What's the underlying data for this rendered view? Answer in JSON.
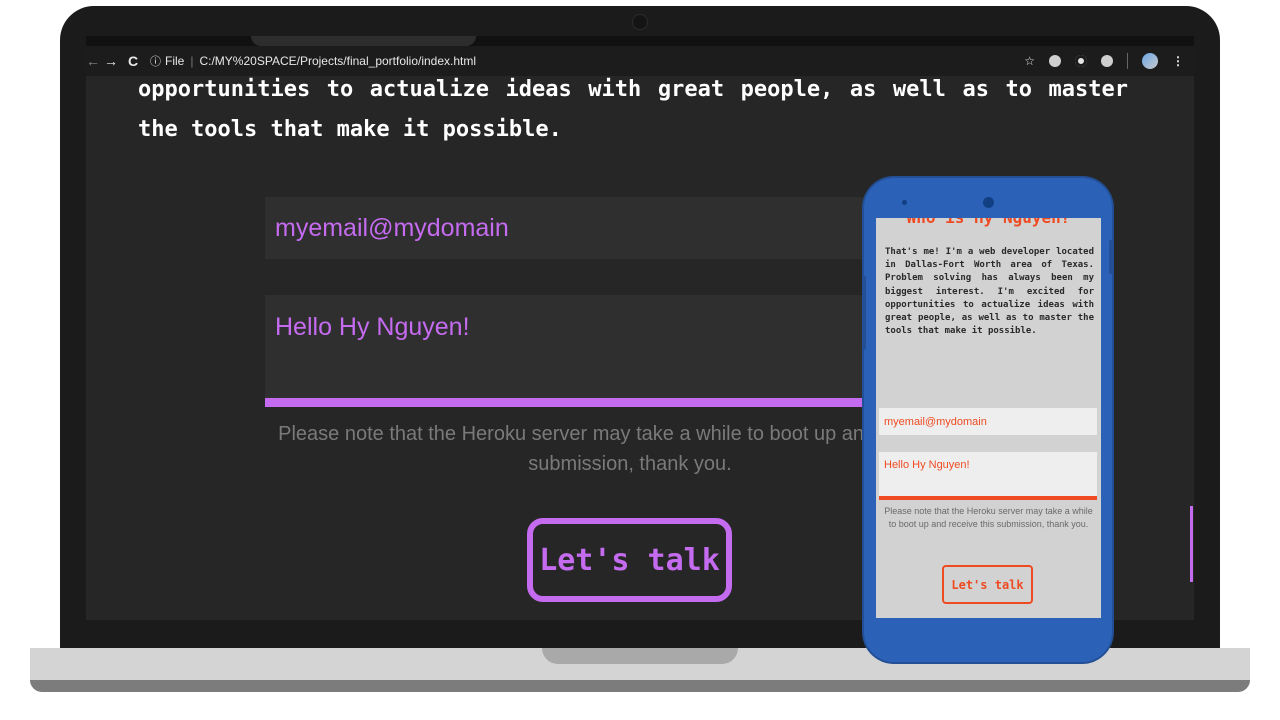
{
  "browser": {
    "back_icon": "←",
    "forward_icon": "→",
    "reload_icon": "C",
    "info_icon": "ⓘ",
    "file_label": "File",
    "url": "C:/MY%20SPACE/Projects/final_portfolio/index.html",
    "star_icon": "☆",
    "menu_icon": "⋮"
  },
  "page": {
    "intro_text": "opportunities to actualize ideas with great people, as well as to master the tools that make it possible.",
    "email_value": "myemail@mydomain",
    "message_value": "Hello Hy Nguyen!",
    "note": "Please note that the Heroku server may take a while to boot up and receive this submission, thank you.",
    "cta_label": "Let's talk"
  },
  "mobile": {
    "title": "Who is Hy Nguyen?",
    "bio": "That's me! I'm a web developer located in Dallas-Fort Worth area of Texas. Problem solving has always been my biggest interest. I'm excited for opportunities to actualize ideas with great people, as well as to master the tools that make it possible.",
    "email_value": "myemail@mydomain",
    "message_value": "Hello Hy Nguyen!",
    "note": "Please note that the Heroku server may take a while to boot up and receive this submission, thank you.",
    "cta_label": "Let's talk"
  },
  "colors": {
    "desktop_accent": "#c56bf0",
    "mobile_accent": "#ee4b22",
    "phone_body": "#2b62b8",
    "page_background": "#262626"
  }
}
